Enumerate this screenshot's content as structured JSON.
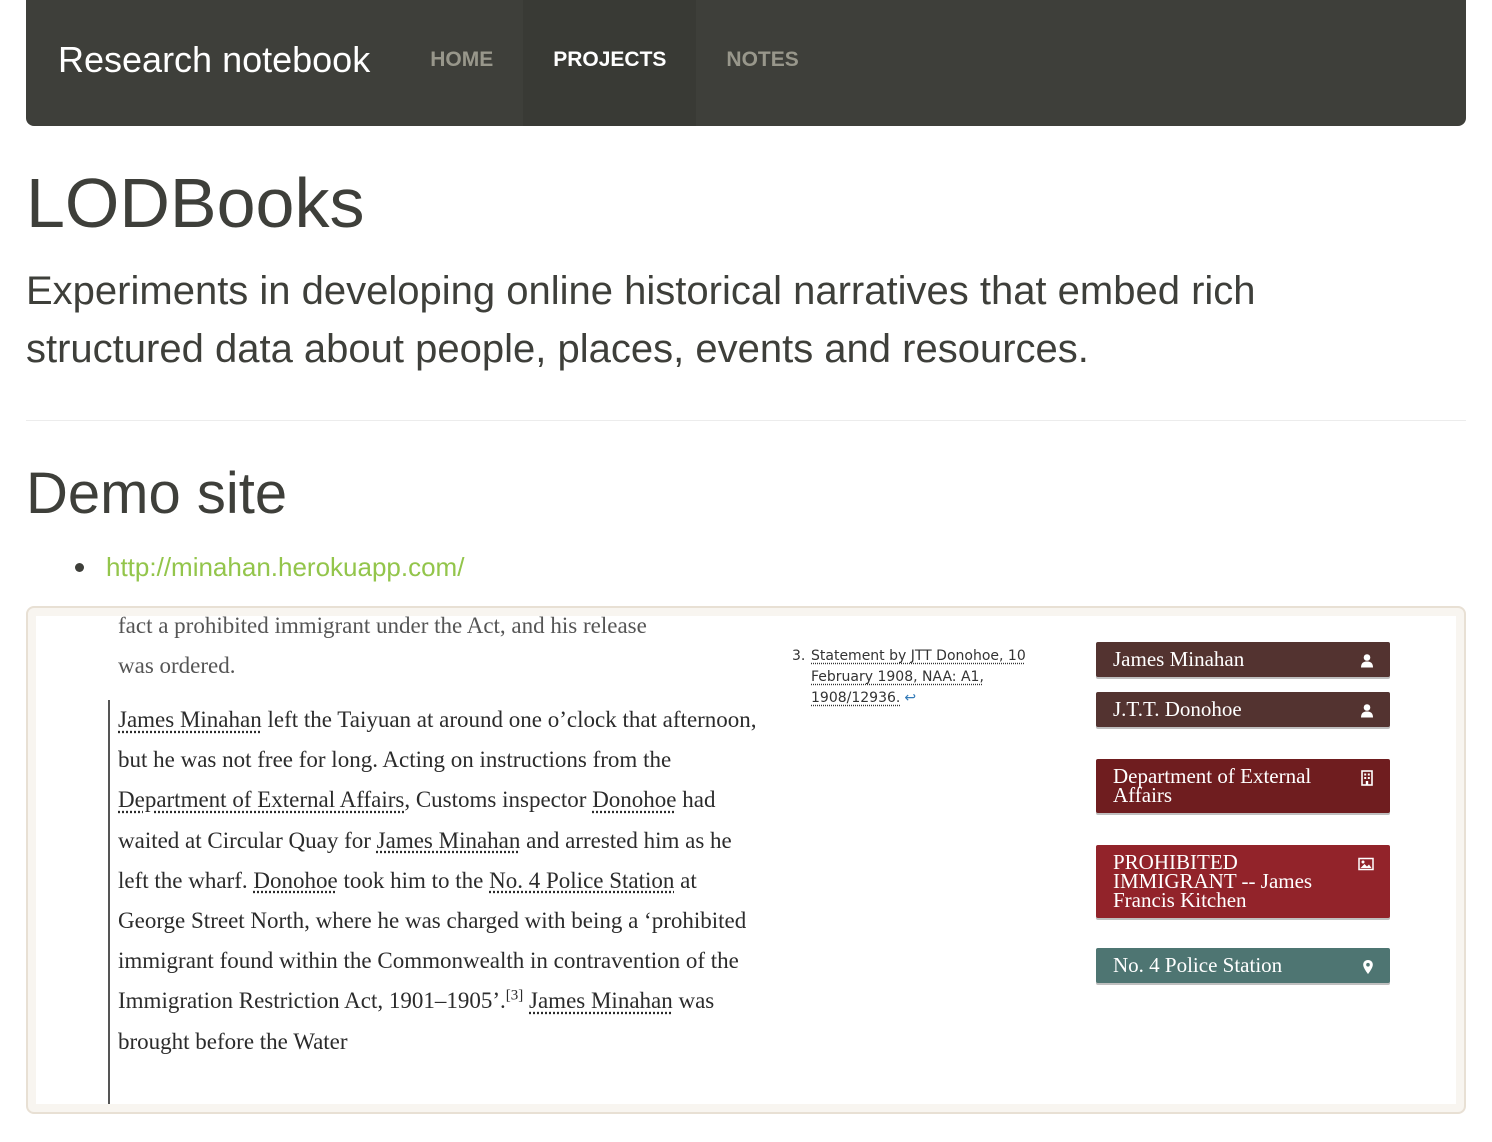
{
  "nav": {
    "brand": "Research notebook",
    "items": [
      {
        "label": "HOME",
        "active": false
      },
      {
        "label": "PROJECTS",
        "active": true
      },
      {
        "label": "NOTES",
        "active": false
      }
    ]
  },
  "header": {
    "title": "LODBooks",
    "lead": "Experiments in developing online historical narratives that embed rich structured data about people, places, events and resources."
  },
  "demo": {
    "heading": "Demo site",
    "links": [
      "http://minahan.herokuapp.com/"
    ]
  },
  "screenshot": {
    "prev_line_1": "fact a prohibited immigrant under the Act, and his release",
    "prev_line_2": "was ordered.",
    "quote": {
      "p1": "James Minahan",
      "p2": " left the Taiyuan at around one o’clock that afternoon, but he was not free for long. Acting on instructions from the ",
      "p3": "Department of External Affairs",
      "p4": ", Customs inspector ",
      "p5": "Donohoe",
      "p6": " had waited at Circular Quay for ",
      "p7": "James Minahan",
      "p8": " and arrested him as he left the wharf. ",
      "p9": "Donohoe",
      "p10": " took him to the ",
      "p11": "No. 4 Police Station",
      "p12": " at George Street North, where he was charged with being a ‘prohibited immigrant found within the Commonwealth in contravention of the Immigration Restriction Act, 1901–1905’.",
      "p13": "[3]",
      "p14": " ",
      "p15": "James Minahan",
      "p16": " was brought before the Water"
    },
    "footnote": {
      "number": "3.",
      "text": "Statement by JTT Donohoe, 10 February 1908, NAA: A1, 1908/12936.",
      "back": "↩"
    },
    "tags": [
      {
        "label": "James Minahan",
        "kind": "person",
        "icon": "person-icon",
        "color": "#533330"
      },
      {
        "label": "J.T.T. Donohoe",
        "kind": "person",
        "icon": "person-icon",
        "color": "#533330"
      },
      {
        "label": "Department of External Affairs",
        "kind": "organisation",
        "icon": "building-icon",
        "color": "#6f1d1f"
      },
      {
        "label": "PROHIBITED IMMIGRANT -- James Francis Kitchen",
        "kind": "image",
        "icon": "picture-icon",
        "color": "#92232a"
      },
      {
        "label": "No. 4 Police Station",
        "kind": "place",
        "icon": "map-marker-icon",
        "color": "#4e7572"
      }
    ]
  }
}
